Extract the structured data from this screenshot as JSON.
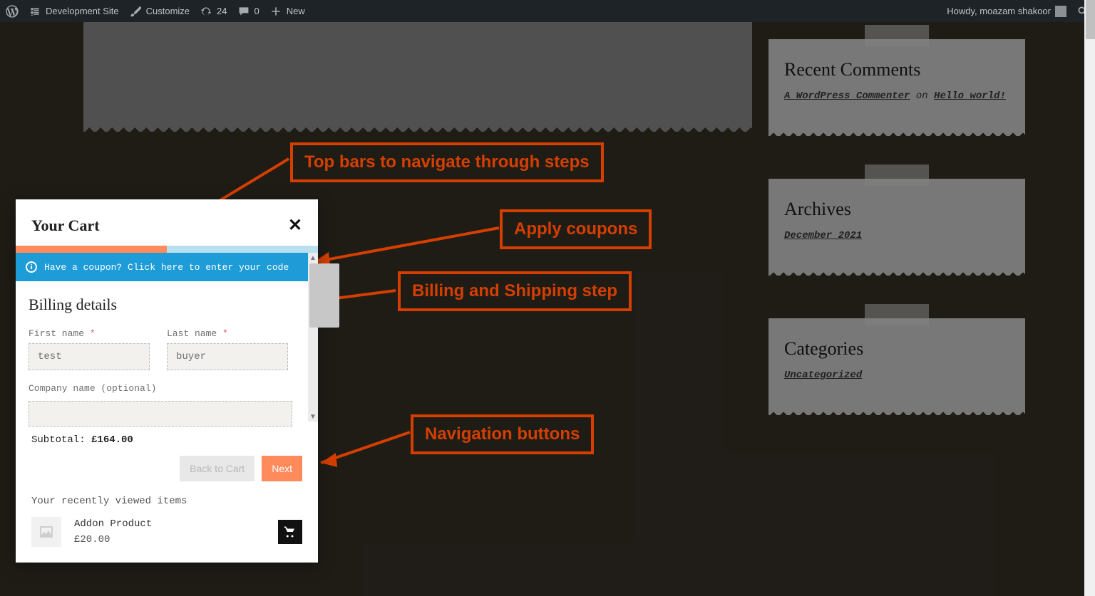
{
  "wp_bar": {
    "site_name": "Development Site",
    "customize": "Customize",
    "updates_count": "24",
    "comments_count": "0",
    "new_label": "New",
    "howdy": "Howdy, moazam shakoor"
  },
  "widgets": {
    "recent_comments": {
      "title": "Recent Comments",
      "commenter": "A WordPress Commenter",
      "on_word": " on ",
      "post": "Hello world!"
    },
    "archives": {
      "title": "Archives",
      "item": "December 2021"
    },
    "categories": {
      "title": "Categories",
      "item": "Uncategorized"
    }
  },
  "annotations": {
    "top_bars": "Top bars to navigate through steps",
    "coupons": "Apply coupons",
    "billing_step": "Billing and Shipping step",
    "nav_buttons": "Navigation buttons"
  },
  "cart": {
    "title": "Your Cart",
    "close": "✕",
    "coupon_text": "Have a coupon? Click here to enter your code",
    "billing_title": "Billing details",
    "first_name_label": "First name",
    "last_name_label": "Last name",
    "first_name_value": "test",
    "last_name_value": "buyer",
    "company_label": "Company name (optional)",
    "subtotal_label": "Subtotal: ",
    "subtotal_value": "£164.00",
    "back_btn": "Back to Cart",
    "next_btn": "Next",
    "recent_title": "Your recently viewed items",
    "recent_item_name": "Addon Product",
    "recent_item_price": "£20.00"
  }
}
